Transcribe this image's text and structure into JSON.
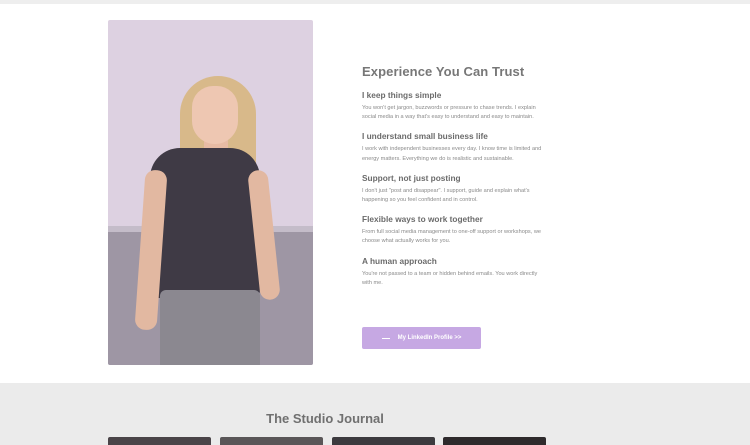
{
  "about": {
    "heading": "Experience You Can Trust",
    "items": [
      {
        "title": "I keep things simple",
        "body": "You won't get jargon, buzzwords or pressure to chase trends. I explain social media in a way that's easy to understand and easy to maintain."
      },
      {
        "title": "I understand small business life",
        "body": "I work with independent businesses every day. I know time is limited and energy matters. Everything we do is realistic and sustainable."
      },
      {
        "title": "Support, not just posting",
        "body": "I don't just \"post and disappear\". I support, guide and explain what's happening so you feel confident and in control."
      },
      {
        "title": "Flexible ways to work together",
        "body": "From full social media management to one-off support or workshops, we choose what actually works for you."
      },
      {
        "title": "A human approach",
        "body": "You're not passed to a team or hidden behind emails. You work directly with me."
      }
    ],
    "button_label": "My LinkedIn Profile >>",
    "button_color": "#c6a8e3"
  },
  "journal": {
    "title": "The Studio Journal",
    "thumb_colors": [
      "#4a4448",
      "#5a5658",
      "#3c3a3e",
      "#2e2a2c"
    ]
  }
}
